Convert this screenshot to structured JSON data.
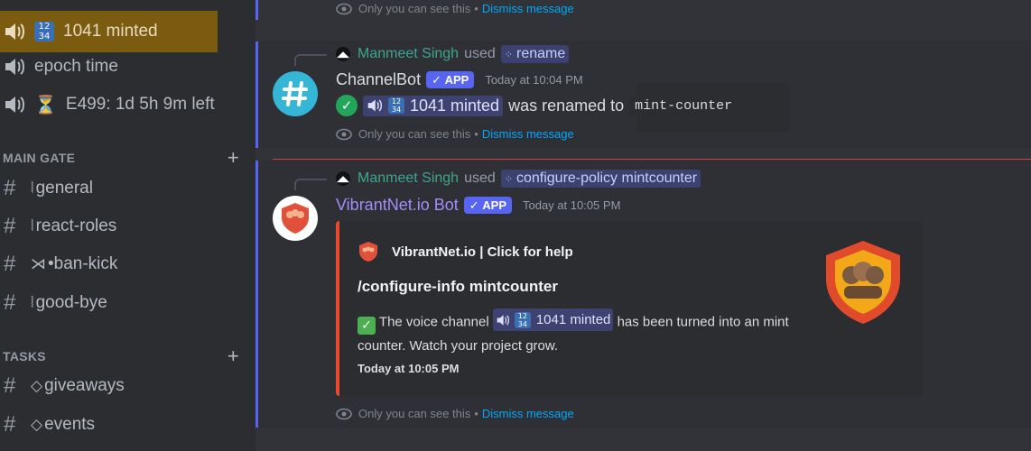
{
  "sidebar": {
    "voice_channels": [
      {
        "icon": "speaker-icon",
        "emoji": "1234",
        "label": "1041 minted",
        "active": true
      },
      {
        "icon": "speaker-icon",
        "emoji": "",
        "label": "epoch time",
        "active": false
      },
      {
        "icon": "speaker-icon",
        "emoji": "⏳",
        "label": "E499: 1d 5h 9m left",
        "active": false
      }
    ],
    "categories": [
      {
        "name": "MAIN GATE",
        "add": "+",
        "channels": [
          {
            "glyph": "⦚",
            "label": "general"
          },
          {
            "glyph": "⦚",
            "label": "react-roles"
          },
          {
            "glyph": "⋊",
            "label": "•ban-kick"
          },
          {
            "glyph": "⦚",
            "label": "good-bye"
          }
        ]
      },
      {
        "name": "TASKS",
        "add": "+",
        "channels": [
          {
            "glyph": "◇",
            "label": "giveaways"
          },
          {
            "glyph": "◇",
            "label": "events"
          }
        ]
      }
    ]
  },
  "chat": {
    "ephemeral": {
      "text": "Only you can see this",
      "separator": "•",
      "dismiss": "Dismiss message"
    },
    "messages": [
      {
        "reply_user": "Manmeet Singh",
        "reply_used": "used",
        "reply_command": "rename",
        "author": "ChannelBot",
        "author_color": "#dbdee1",
        "tag": "APP",
        "timestamp": "Today at 10:04 PM",
        "check": "✓",
        "mention_label": "1041 minted",
        "mention_emoji": "1234",
        "text": "was renamed to",
        "code": "mint-counter"
      },
      {
        "reply_user": "Manmeet Singh",
        "reply_used": "used",
        "reply_command": "configure-policy mintcounter",
        "author": "VibrantNet.io Bot",
        "author_color": "#a78bfa",
        "tag": "APP",
        "timestamp": "Today at 10:05 PM",
        "embed": {
          "author": "VibrantNet.io | Click for help",
          "title": "/configure-info mintcounter",
          "desc_pre": "The voice channel",
          "mention_label": "1041 minted",
          "desc_post": "has been turned into an mint counter. Watch your project grow.",
          "footer": "Today at 10:05 PM",
          "border_color": "#e54b2c"
        }
      }
    ]
  }
}
